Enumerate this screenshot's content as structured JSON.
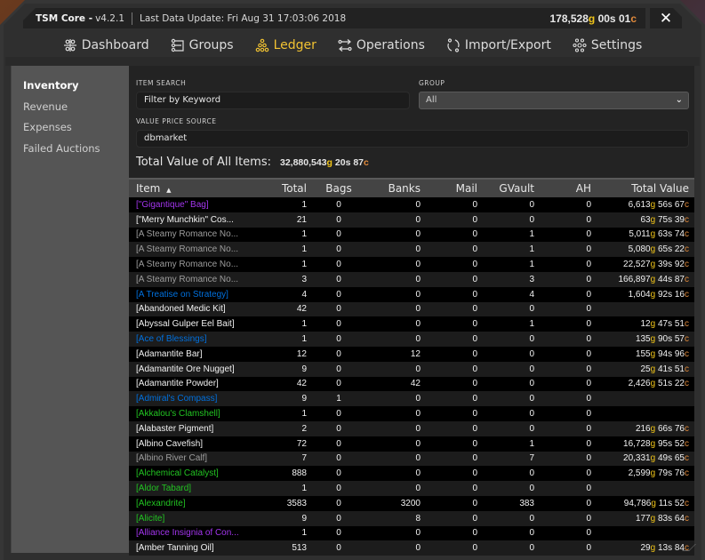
{
  "window": {
    "app_name": "TSM Core -",
    "version": "v4.2.1",
    "last_update": "Last Data Update: Fri Aug 31 17:03:06 2018",
    "gold": {
      "g": "178,528",
      "s": "00",
      "c": "01"
    },
    "close_label": "✕"
  },
  "colors": {
    "accent": "#f1c232",
    "gold": "#f0c419",
    "copper": "#e08a3c",
    "quality_epic": "#a335ee",
    "quality_rare": "#0070dd",
    "quality_uncommon": "#22c322",
    "quality_poor": "#9d9d9d"
  },
  "nav": [
    {
      "label": "Dashboard",
      "icon": "dashboard-icon",
      "active": false
    },
    {
      "label": "Groups",
      "icon": "groups-icon",
      "active": false
    },
    {
      "label": "Ledger",
      "icon": "ledger-icon",
      "active": true
    },
    {
      "label": "Operations",
      "icon": "operations-icon",
      "active": false
    },
    {
      "label": "Import/Export",
      "icon": "import-export-icon",
      "active": false
    },
    {
      "label": "Settings",
      "icon": "settings-icon",
      "active": false
    }
  ],
  "sidebar": [
    {
      "label": "Inventory",
      "active": true
    },
    {
      "label": "Revenue",
      "active": false
    },
    {
      "label": "Expenses",
      "active": false
    },
    {
      "label": "Failed Auctions",
      "active": false
    }
  ],
  "filters": {
    "item_search_label": "ITEM SEARCH",
    "item_search_placeholder": "Filter by Keyword",
    "group_label": "GROUP",
    "group_value": "All",
    "price_source_label": "VALUE PRICE SOURCE",
    "price_source_value": "dbmarket"
  },
  "summary": {
    "label": "Total Value of All Items:",
    "value": {
      "g": "32,880,543",
      "s": "20",
      "c": "87"
    }
  },
  "table": {
    "columns": [
      "Item",
      "Total",
      "Bags",
      "Banks",
      "Mail",
      "GVault",
      "AH",
      "Total Value"
    ],
    "sort_indicator": "▲",
    "rows": [
      {
        "item": "[\"Gigantique\" Bag]",
        "quality": "epic",
        "total": "1",
        "bags": "0",
        "banks": "0",
        "mail": "0",
        "gvault": "0",
        "ah": "0",
        "value": {
          "g": "6,613",
          "s": "56",
          "c": "67"
        }
      },
      {
        "item": "[\"Merry Munchkin\" Cos...",
        "quality": "common",
        "total": "21",
        "bags": "0",
        "banks": "0",
        "mail": "0",
        "gvault": "0",
        "ah": "0",
        "value": {
          "g": "63",
          "s": "75",
          "c": "39"
        }
      },
      {
        "item": "[A Steamy Romance No...",
        "quality": "poor",
        "total": "1",
        "bags": "0",
        "banks": "0",
        "mail": "0",
        "gvault": "1",
        "ah": "0",
        "value": {
          "g": "5,011",
          "s": "63",
          "c": "74"
        }
      },
      {
        "item": "[A Steamy Romance No...",
        "quality": "poor",
        "total": "1",
        "bags": "0",
        "banks": "0",
        "mail": "0",
        "gvault": "1",
        "ah": "0",
        "value": {
          "g": "5,080",
          "s": "65",
          "c": "22"
        }
      },
      {
        "item": "[A Steamy Romance No...",
        "quality": "poor",
        "total": "1",
        "bags": "0",
        "banks": "0",
        "mail": "0",
        "gvault": "1",
        "ah": "0",
        "value": {
          "g": "22,527",
          "s": "39",
          "c": "92"
        }
      },
      {
        "item": "[A Steamy Romance No...",
        "quality": "poor",
        "total": "3",
        "bags": "0",
        "banks": "0",
        "mail": "0",
        "gvault": "3",
        "ah": "0",
        "value": {
          "g": "166,897",
          "s": "44",
          "c": "87"
        }
      },
      {
        "item": "[A Treatise on Strategy]",
        "quality": "rare",
        "total": "4",
        "bags": "0",
        "banks": "0",
        "mail": "0",
        "gvault": "4",
        "ah": "0",
        "value": {
          "g": "1,604",
          "s": "92",
          "c": "16"
        }
      },
      {
        "item": "[Abandoned Medic Kit]",
        "quality": "common",
        "total": "42",
        "bags": "0",
        "banks": "0",
        "mail": "0",
        "gvault": "0",
        "ah": "0",
        "value": null
      },
      {
        "item": "[Abyssal Gulper Eel Bait]",
        "quality": "common",
        "total": "1",
        "bags": "0",
        "banks": "0",
        "mail": "0",
        "gvault": "1",
        "ah": "0",
        "value": {
          "g": "12",
          "s": "47",
          "c": "51"
        }
      },
      {
        "item": "[Ace of Blessings]",
        "quality": "rare",
        "total": "1",
        "bags": "0",
        "banks": "0",
        "mail": "0",
        "gvault": "0",
        "ah": "0",
        "value": {
          "g": "135",
          "s": "90",
          "c": "57"
        }
      },
      {
        "item": "[Adamantite Bar]",
        "quality": "common",
        "total": "12",
        "bags": "0",
        "banks": "12",
        "mail": "0",
        "gvault": "0",
        "ah": "0",
        "value": {
          "g": "155",
          "s": "94",
          "c": "96"
        }
      },
      {
        "item": "[Adamantite Ore Nugget]",
        "quality": "common",
        "total": "9",
        "bags": "0",
        "banks": "0",
        "mail": "0",
        "gvault": "0",
        "ah": "0",
        "value": {
          "g": "25",
          "s": "41",
          "c": "51"
        }
      },
      {
        "item": "[Adamantite Powder]",
        "quality": "common",
        "total": "42",
        "bags": "0",
        "banks": "42",
        "mail": "0",
        "gvault": "0",
        "ah": "0",
        "value": {
          "g": "2,426",
          "s": "51",
          "c": "22"
        }
      },
      {
        "item": "[Admiral's Compass]",
        "quality": "rare",
        "total": "9",
        "bags": "1",
        "banks": "0",
        "mail": "0",
        "gvault": "0",
        "ah": "0",
        "value": null
      },
      {
        "item": "[Akkalou's Clamshell]",
        "quality": "uncommon",
        "total": "1",
        "bags": "0",
        "banks": "0",
        "mail": "0",
        "gvault": "0",
        "ah": "0",
        "value": null
      },
      {
        "item": "[Alabaster Pigment]",
        "quality": "common",
        "total": "2",
        "bags": "0",
        "banks": "0",
        "mail": "0",
        "gvault": "0",
        "ah": "0",
        "value": {
          "g": "216",
          "s": "66",
          "c": "76"
        }
      },
      {
        "item": "[Albino Cavefish]",
        "quality": "common",
        "total": "72",
        "bags": "0",
        "banks": "0",
        "mail": "0",
        "gvault": "1",
        "ah": "0",
        "value": {
          "g": "16,728",
          "s": "95",
          "c": "52"
        }
      },
      {
        "item": "[Albino River Calf]",
        "quality": "poor",
        "total": "7",
        "bags": "0",
        "banks": "0",
        "mail": "0",
        "gvault": "7",
        "ah": "0",
        "value": {
          "g": "20,331",
          "s": "49",
          "c": "65"
        }
      },
      {
        "item": "[Alchemical Catalyst]",
        "quality": "uncommon",
        "total": "888",
        "bags": "0",
        "banks": "0",
        "mail": "0",
        "gvault": "0",
        "ah": "0",
        "value": {
          "g": "2,599",
          "s": "79",
          "c": "76"
        }
      },
      {
        "item": "[Aldor Tabard]",
        "quality": "uncommon",
        "total": "1",
        "bags": "0",
        "banks": "0",
        "mail": "0",
        "gvault": "0",
        "ah": "0",
        "value": null
      },
      {
        "item": "[Alexandrite]",
        "quality": "uncommon",
        "total": "3583",
        "bags": "0",
        "banks": "3200",
        "mail": "0",
        "gvault": "383",
        "ah": "0",
        "value": {
          "g": "94,786",
          "s": "11",
          "c": "52"
        }
      },
      {
        "item": "[Alicite]",
        "quality": "uncommon",
        "total": "9",
        "bags": "0",
        "banks": "8",
        "mail": "0",
        "gvault": "0",
        "ah": "0",
        "value": {
          "g": "177",
          "s": "83",
          "c": "64"
        }
      },
      {
        "item": "[Alliance Insignia of Con...",
        "quality": "epic",
        "total": "1",
        "bags": "0",
        "banks": "0",
        "mail": "0",
        "gvault": "0",
        "ah": "0",
        "value": null
      },
      {
        "item": "[Amber Tanning Oil]",
        "quality": "common",
        "total": "513",
        "bags": "0",
        "banks": "0",
        "mail": "0",
        "gvault": "0",
        "ah": "0",
        "value": {
          "g": "29",
          "s": "13",
          "c": "84"
        }
      }
    ]
  }
}
